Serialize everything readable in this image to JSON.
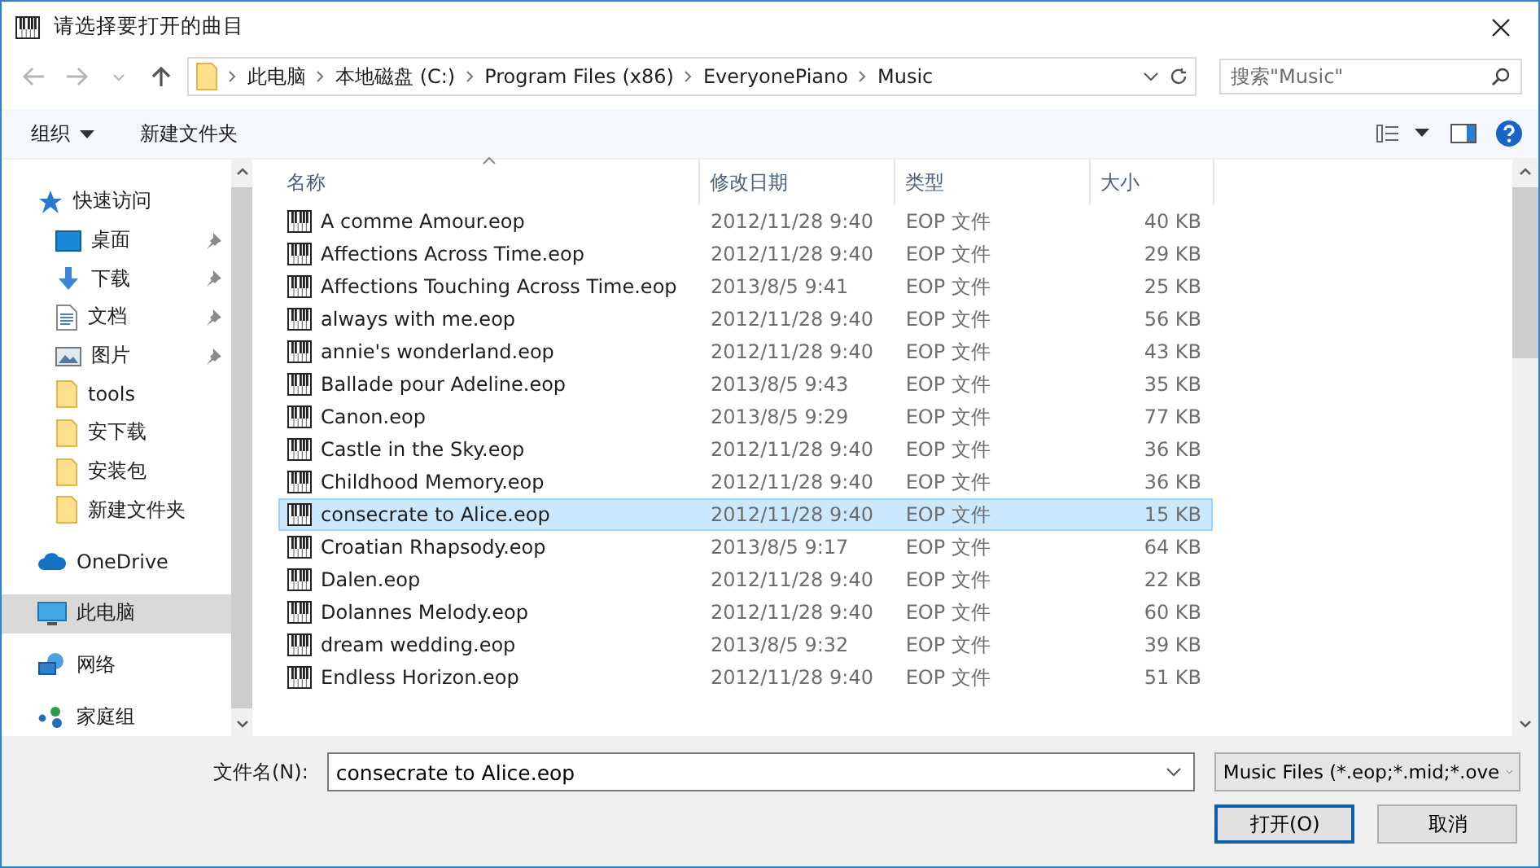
{
  "window": {
    "title": "请选择要打开的曲目"
  },
  "address": {
    "breadcrumbs": [
      "此电脑",
      "本地磁盘 (C:)",
      "Program Files (x86)",
      "EveryonePiano",
      "Music"
    ]
  },
  "search": {
    "placeholder": "搜索\"Music\""
  },
  "toolbar": {
    "organize": "组织",
    "new_folder": "新建文件夹"
  },
  "sidebar": {
    "items": [
      {
        "kind": "quick-access",
        "label": "快速访问",
        "pinned": false,
        "selected": false
      },
      {
        "kind": "desktop",
        "label": "桌面",
        "pinned": true,
        "selected": false
      },
      {
        "kind": "downloads",
        "label": "下载",
        "pinned": true,
        "selected": false
      },
      {
        "kind": "documents",
        "label": "文档",
        "pinned": true,
        "selected": false
      },
      {
        "kind": "pictures",
        "label": "图片",
        "pinned": true,
        "selected": false
      },
      {
        "kind": "folder",
        "label": "tools",
        "pinned": false,
        "selected": false
      },
      {
        "kind": "folder",
        "label": "安下载",
        "pinned": false,
        "selected": false
      },
      {
        "kind": "folder",
        "label": "安装包",
        "pinned": false,
        "selected": false
      },
      {
        "kind": "folder",
        "label": "新建文件夹",
        "pinned": false,
        "selected": false
      },
      {
        "kind": "cloud",
        "label": "OneDrive",
        "pinned": false,
        "selected": false
      },
      {
        "kind": "computer",
        "label": "此电脑",
        "pinned": false,
        "selected": true
      },
      {
        "kind": "network",
        "label": "网络",
        "pinned": false,
        "selected": false
      },
      {
        "kind": "homegroup",
        "label": "家庭组",
        "pinned": false,
        "selected": false
      }
    ]
  },
  "table": {
    "columns": [
      {
        "label": "名称",
        "sorted": true
      },
      {
        "label": "修改日期",
        "sorted": false
      },
      {
        "label": "类型",
        "sorted": false
      },
      {
        "label": "大小",
        "sorted": false
      }
    ],
    "rows": [
      {
        "name": "A comme Amour.eop",
        "modified": "2012/11/28 9:40",
        "type": "EOP 文件",
        "size": "40 KB",
        "selected": false
      },
      {
        "name": "Affections Across Time.eop",
        "modified": "2012/11/28 9:40",
        "type": "EOP 文件",
        "size": "29 KB",
        "selected": false
      },
      {
        "name": "Affections Touching Across Time.eop",
        "modified": "2013/8/5 9:41",
        "type": "EOP 文件",
        "size": "25 KB",
        "selected": false
      },
      {
        "name": "always with me.eop",
        "modified": "2012/11/28 9:40",
        "type": "EOP 文件",
        "size": "56 KB",
        "selected": false
      },
      {
        "name": "annie's wonderland.eop",
        "modified": "2012/11/28 9:40",
        "type": "EOP 文件",
        "size": "43 KB",
        "selected": false
      },
      {
        "name": "Ballade pour Adeline.eop",
        "modified": "2013/8/5 9:43",
        "type": "EOP 文件",
        "size": "35 KB",
        "selected": false
      },
      {
        "name": "Canon.eop",
        "modified": "2013/8/5 9:29",
        "type": "EOP 文件",
        "size": "77 KB",
        "selected": false
      },
      {
        "name": "Castle in the Sky.eop",
        "modified": "2012/11/28 9:40",
        "type": "EOP 文件",
        "size": "36 KB",
        "selected": false
      },
      {
        "name": "Childhood Memory.eop",
        "modified": "2012/11/28 9:40",
        "type": "EOP 文件",
        "size": "36 KB",
        "selected": false
      },
      {
        "name": "consecrate to Alice.eop",
        "modified": "2012/11/28 9:40",
        "type": "EOP 文件",
        "size": "15 KB",
        "selected": true
      },
      {
        "name": "Croatian Rhapsody.eop",
        "modified": "2013/8/5 9:17",
        "type": "EOP 文件",
        "size": "64 KB",
        "selected": false
      },
      {
        "name": "Dalen.eop",
        "modified": "2012/11/28 9:40",
        "type": "EOP 文件",
        "size": "22 KB",
        "selected": false
      },
      {
        "name": "Dolannes Melody.eop",
        "modified": "2012/11/28 9:40",
        "type": "EOP 文件",
        "size": "60 KB",
        "selected": false
      },
      {
        "name": "dream wedding.eop",
        "modified": "2013/8/5 9:32",
        "type": "EOP 文件",
        "size": "39 KB",
        "selected": false
      },
      {
        "name": "Endless Horizon.eop",
        "modified": "2012/11/28 9:40",
        "type": "EOP 文件",
        "size": "51 KB",
        "selected": false
      }
    ]
  },
  "footer": {
    "filename_label": "文件名(N):",
    "filename": "consecrate to Alice.eop",
    "filter": "Music Files (*.eop;*.mid;*.ove",
    "open_button": "打开(O)",
    "cancel_button": "取消"
  }
}
